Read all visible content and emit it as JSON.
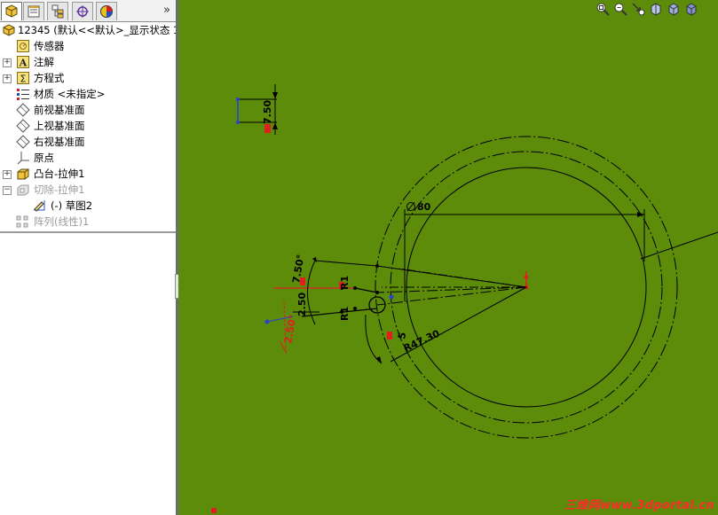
{
  "panel": {
    "tabs": [
      {
        "name": "FeatureManager design tree",
        "icon": "feature-manager-icon"
      },
      {
        "name": "PropertyManager",
        "icon": "property-manager-icon"
      },
      {
        "name": "ConfigurationManager",
        "icon": "configuration-manager-icon"
      },
      {
        "name": "DimXpertManager",
        "icon": "dimxpert-icon"
      },
      {
        "name": "Display Manager",
        "icon": "display-manager-icon"
      }
    ],
    "more": "»"
  },
  "tree": {
    "root": "12345    (默认<<默认>_显示状态 1",
    "items": [
      {
        "label": "传感器",
        "icon": "sensor-icon",
        "expander": ""
      },
      {
        "label": "注解",
        "icon": "annotation-icon",
        "expander": "+"
      },
      {
        "label": "方程式",
        "icon": "equation-icon",
        "expander": "+"
      },
      {
        "label": "材质 <未指定>",
        "icon": "material-icon",
        "expander": ""
      },
      {
        "label": "前视基准面",
        "icon": "plane-icon",
        "expander": ""
      },
      {
        "label": "上视基准面",
        "icon": "plane-icon",
        "expander": ""
      },
      {
        "label": "右视基准面",
        "icon": "plane-icon",
        "expander": ""
      },
      {
        "label": "原点",
        "icon": "origin-icon",
        "expander": ""
      },
      {
        "label": "凸台-拉伸1",
        "icon": "boss-extrude-icon",
        "expander": "+"
      },
      {
        "label": "切除-拉伸1",
        "icon": "cut-extrude-icon",
        "expander": "−"
      },
      {
        "label": "(-) 草图2",
        "icon": "sketch-icon",
        "expander": ""
      },
      {
        "label": "阵列(线性)1",
        "icon": "linear-pattern-icon",
        "expander": ""
      }
    ]
  },
  "dimensions": {
    "height": "7.50",
    "diameter": "80",
    "angle": "7.50°",
    "offset": "2.50",
    "radius": "R1",
    "radius2": "R1",
    "lower_angle": "2.50°",
    "width": "5",
    "r_outer": "R47.30"
  },
  "watermark": "三维网www.3dportal.cn",
  "colors": {
    "viewport": "#5c8c0a",
    "constraint": "#e02020",
    "point": "#2a40d0"
  }
}
